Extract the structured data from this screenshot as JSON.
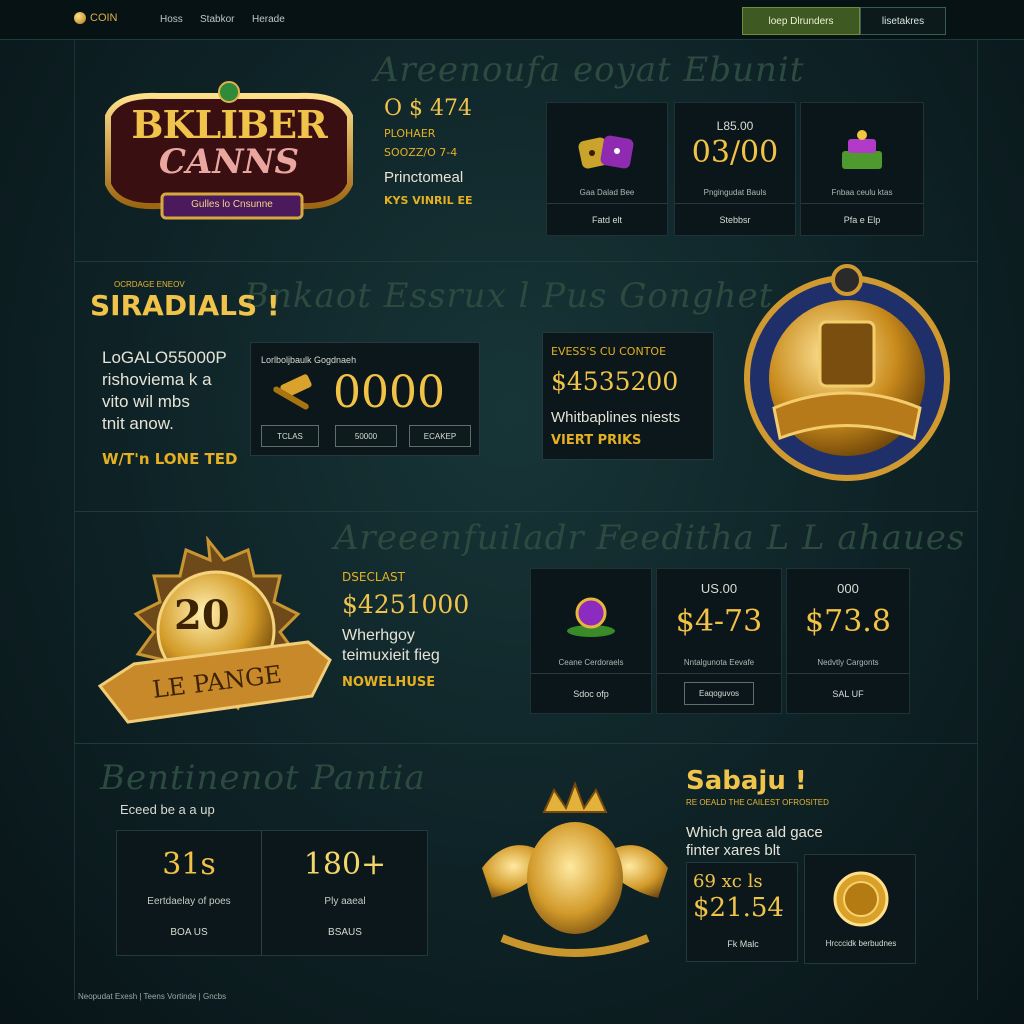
{
  "header": {
    "brand": "COIN",
    "nav": [
      "Hoss",
      "Stabkor",
      "Herade"
    ],
    "btn_primary": "loep Dlrunders",
    "btn_secondary": "lisetakres"
  },
  "hero": {
    "ghost_title": "Areenoufa eoyat  Ebunit",
    "logo_top": "BKLIBER",
    "logo_bottom": "CANNS",
    "logo_ribbon": "Gulles lo Cnsunne",
    "stat_value": "O $ 474",
    "stat_label": "PLOHAER",
    "stat_sub": "SOOZZ/O 7-4",
    "stat_desc": "Princtomeal",
    "stat_tag": "KYS VINRIL EE",
    "cards": [
      {
        "icon": "dice-icon",
        "caption": "Gaa Dalad Bee",
        "footer": "Fatd elt"
      },
      {
        "top": "L85.00",
        "value": "03/00",
        "caption": "Pngingudat Bauls",
        "footer": "Stebbsr"
      },
      {
        "icon": "cake-icon",
        "caption": "Fnbaa ceulu ktas",
        "footer": "Pfa e Elp"
      }
    ]
  },
  "specials": {
    "ghost_title": "Bnkaot  Essrux  l Pus  Gonghet",
    "kicker": "OCRDAGE ENEOV",
    "title": "SIRADIALS !",
    "desc_line1": "LoGALO55000P",
    "desc_line2": "rishoviema k a",
    "desc_line3": "vito wil mbs",
    "desc_line4": "tnit anow.",
    "desc_tag": "W/T'n LONE TED",
    "jackpot_label": "Lorlboljbaulk Gogdnaeh",
    "jackpot_value": "0000",
    "jackpot_btns": [
      "TCLAS",
      "50000",
      "ECAKEP"
    ],
    "offer_label": "EVESS'S CU CONTOE",
    "offer_value": "$4535200",
    "offer_desc": "Whitbaplines niests",
    "offer_tag": "VIERT PRIKS"
  },
  "bonus": {
    "ghost_title": "Areeenfuiladr  Feeditha  L L  ahaues",
    "medal_value": "20",
    "medal_ribbon": "LE PANGE",
    "kicker": "DSECLAST",
    "value": "$4251000",
    "desc_line1": "Wherhgoy",
    "desc_line2": "teimuxieit fieg",
    "tag": "NOWELHUSE",
    "cards": [
      {
        "icon": "gem-icon",
        "caption": "Ceane Cerdoraels",
        "footer": "Sdoc ofp"
      },
      {
        "top": "US.00",
        "value": "$4-73",
        "caption": "Nntalgunota Eevafe",
        "footer": "Eaqoguvos"
      },
      {
        "top": "000",
        "value": "$73.8",
        "caption": "Nedvtly Cargonts",
        "footer": "SAL UF"
      }
    ]
  },
  "rewards": {
    "ghost_title": "Bentinenot  Pantia",
    "sub": "Eceed be a a up",
    "stats": [
      {
        "value": "31s",
        "label": "Eertdaelay of poes",
        "footer": "BOA US"
      },
      {
        "value": "180+",
        "label": "Ply aaeal",
        "footer": "BSAUS"
      }
    ],
    "kicker": "RE OEALD THE CAILEST OFROSITED",
    "title": "Sabaju !",
    "desc_line1": "Which grea ald gace",
    "desc_line2": "finter xares blt",
    "stat_top": "69 xc ls",
    "stat_value": "$21.54",
    "stat_footer": "Fk Malc",
    "coin_caption": "Hrcccidk berbudnes"
  },
  "footer": {
    "text": "Neopudat Exesh | Teens Vortinde | Gncbs"
  },
  "colors": {
    "gold": "#e8b533",
    "accent_green": "#3e5a22",
    "bg": "#0e2226"
  }
}
